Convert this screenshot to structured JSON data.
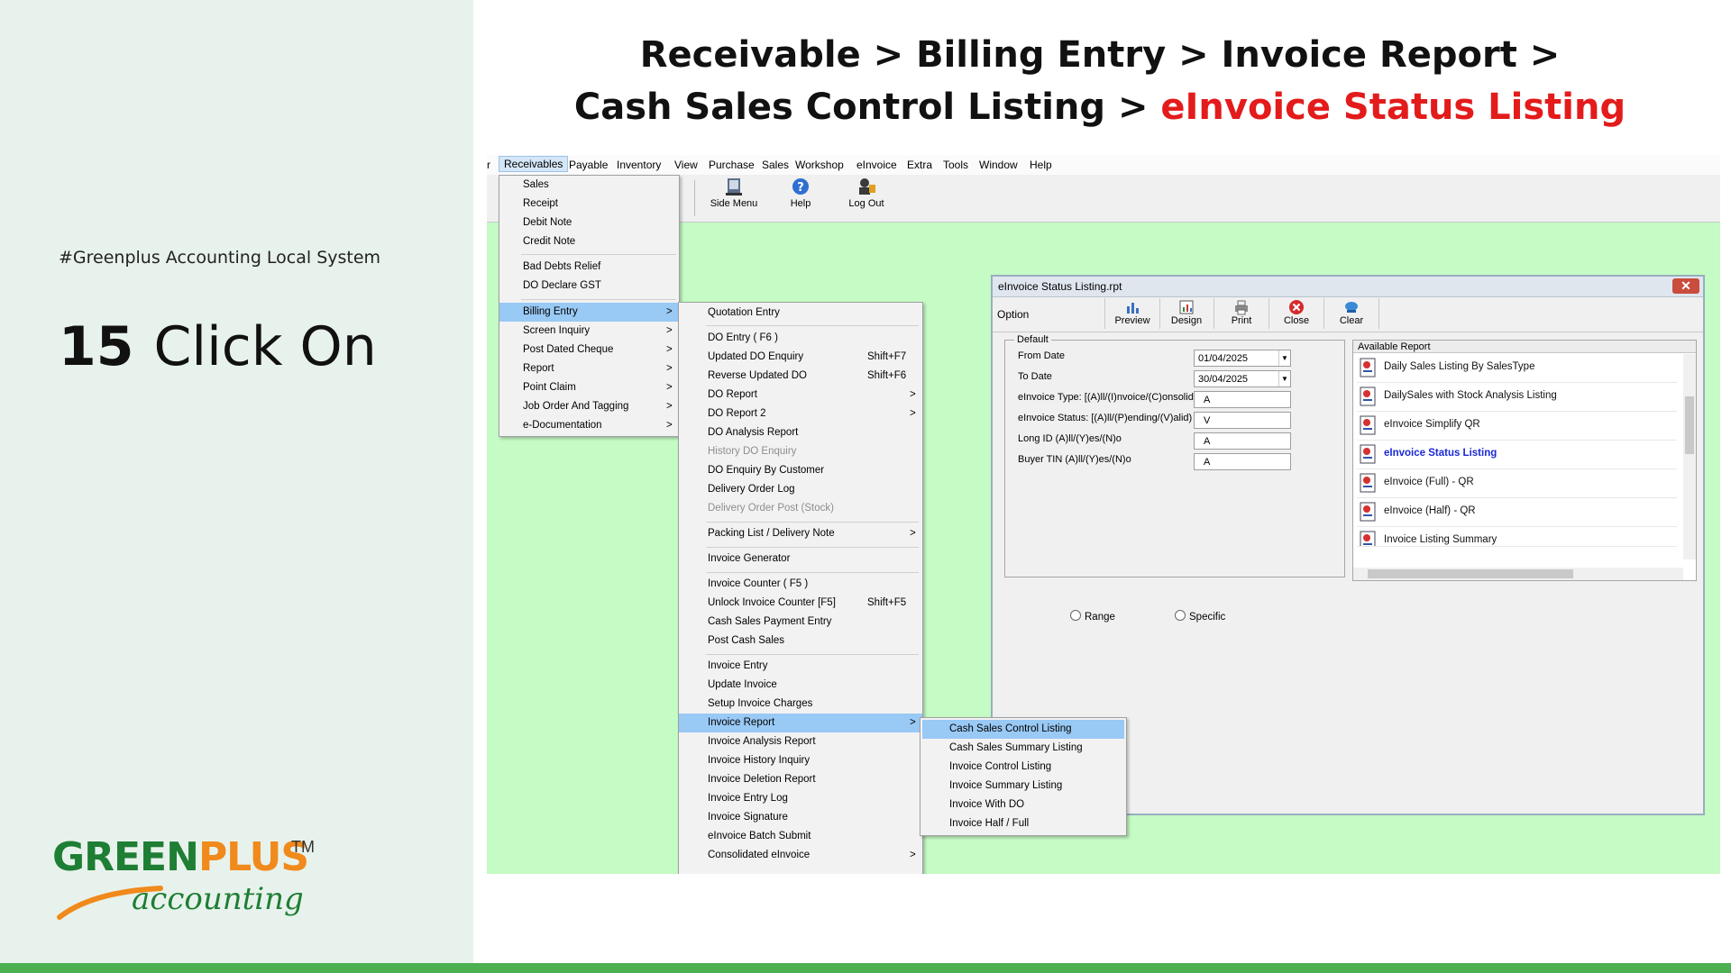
{
  "slide": {
    "hashtag": "#Greenplus Accounting Local System",
    "step_number": "15",
    "step_action": "Click On",
    "title_line1": "Receivable > Billing Entry > Invoice Report >",
    "title_line2_prefix": "Cash Sales Control Listing > ",
    "title_line2_highlight": "eInvoice Status Listing",
    "logo": {
      "word1": "GREEN",
      "word2": "PLUS",
      "tm": "TM",
      "tagline": "accounting"
    },
    "colors": {
      "highlight_red": "#e31b1b",
      "brand_green": "#1e7e34",
      "brand_orange": "#f08a1c",
      "bottom_bar": "#4caf50"
    }
  },
  "menubar": {
    "items": [
      "r",
      "Receivables",
      "Payable",
      "Inventory",
      "View",
      "Purchase",
      "Sales",
      "Workshop",
      "eInvoice",
      "Extra",
      "Tools",
      "Window",
      "Help"
    ]
  },
  "toolbar": {
    "side_menu": "Side Menu",
    "help": "Help",
    "log_out": "Log Out"
  },
  "receivables_menu": {
    "items": [
      {
        "label": "Sales"
      },
      {
        "label": "Receipt"
      },
      {
        "label": "Debit Note"
      },
      {
        "label": "Credit Note"
      },
      {
        "label": "Bad Debts Relief"
      },
      {
        "label": "DO Declare GST"
      },
      {
        "label": "Billing Entry",
        "arrow": ">"
      },
      {
        "label": "Screen Inquiry",
        "arrow": ">"
      },
      {
        "label": "Post Dated Cheque",
        "arrow": ">"
      },
      {
        "label": "Report",
        "arrow": ">"
      },
      {
        "label": "Point Claim",
        "arrow": ">"
      },
      {
        "label": "Job Order And Tagging",
        "arrow": ">"
      },
      {
        "label": "e-Documentation",
        "arrow": ">"
      }
    ]
  },
  "billing_menu": {
    "items": [
      {
        "label": "Quotation Entry"
      },
      {
        "label": "DO Entry  ( F6 )"
      },
      {
        "label": "Updated DO Enquiry",
        "shortcut": "Shift+F7"
      },
      {
        "label": "Reverse Updated DO",
        "shortcut": "Shift+F6"
      },
      {
        "label": "DO Report",
        "arrow": ">"
      },
      {
        "label": "DO Report 2",
        "arrow": ">"
      },
      {
        "label": "DO Analysis Report"
      },
      {
        "label": "History DO Enquiry"
      },
      {
        "label": "DO Enquiry By Customer"
      },
      {
        "label": "Delivery Order Log"
      },
      {
        "label": "Delivery Order Post (Stock)"
      },
      {
        "label": "Packing List / Delivery Note",
        "arrow": ">"
      },
      {
        "label": "Invoice Generator"
      },
      {
        "label": "Invoice Counter   ( F5 )"
      },
      {
        "label": "Unlock Invoice Counter [F5]",
        "shortcut": "Shift+F5"
      },
      {
        "label": "Cash Sales Payment Entry"
      },
      {
        "label": "Post Cash Sales"
      },
      {
        "label": "Invoice Entry"
      },
      {
        "label": "Update Invoice"
      },
      {
        "label": "Setup Invoice Charges"
      },
      {
        "label": "Invoice Report",
        "arrow": ">"
      },
      {
        "label": "Invoice Analysis Report"
      },
      {
        "label": "Invoice History Inquiry"
      },
      {
        "label": "Invoice Deletion Report"
      },
      {
        "label": "Invoice Entry Log"
      },
      {
        "label": "Invoice Signature"
      },
      {
        "label": "eInvoice Batch Submit"
      },
      {
        "label": "Consolidated eInvoice",
        "arrow": ">"
      }
    ]
  },
  "invoice_report_menu": {
    "items": [
      {
        "label": "Cash Sales Control Listing"
      },
      {
        "label": "Cash Sales Summary Listing"
      },
      {
        "label": "Invoice Control Listing"
      },
      {
        "label": "Invoice Summary Listing"
      },
      {
        "label": "Invoice With DO"
      },
      {
        "label": "Invoice Half / Full"
      }
    ]
  },
  "report_window": {
    "title": "eInvoice Status Listing.rpt",
    "close_x": "✕",
    "option_label": "Option",
    "buttons": [
      "Preview",
      "Design",
      "Print",
      "Close",
      "Clear"
    ],
    "default_legend": "Default",
    "fields": [
      {
        "label": "From Date",
        "value": "01/04/2025",
        "dropdown": true
      },
      {
        "label": "To Date",
        "value": "30/04/2025",
        "dropdown": true
      },
      {
        "label": "eInvoice Type: [(A)ll/(I)nvoice/(C)onsolidated)",
        "value": "A"
      },
      {
        "label": "eInvoice Status: [(A)ll/(P)ending/(V)alid)",
        "value": "V"
      },
      {
        "label": "Long ID (A)ll/(Y)es/(N)o",
        "value": "A"
      },
      {
        "label": "Buyer TIN (A)ll/(Y)es/(N)o",
        "value": "A"
      }
    ],
    "available_report_header": "Available Report",
    "available_reports": [
      "Daily Sales Listing By SalesType",
      "DailySales with Stock Analysis Listing",
      "eInvoice Simplify QR",
      "eInvoice Status Listing",
      "eInvoice (Full) - QR",
      "eInvoice (Half) - QR",
      "Invoice Listing Summary"
    ],
    "selected_report": "eInvoice Status Listing",
    "radio_range": "Range",
    "radio_specific": "Specific"
  }
}
